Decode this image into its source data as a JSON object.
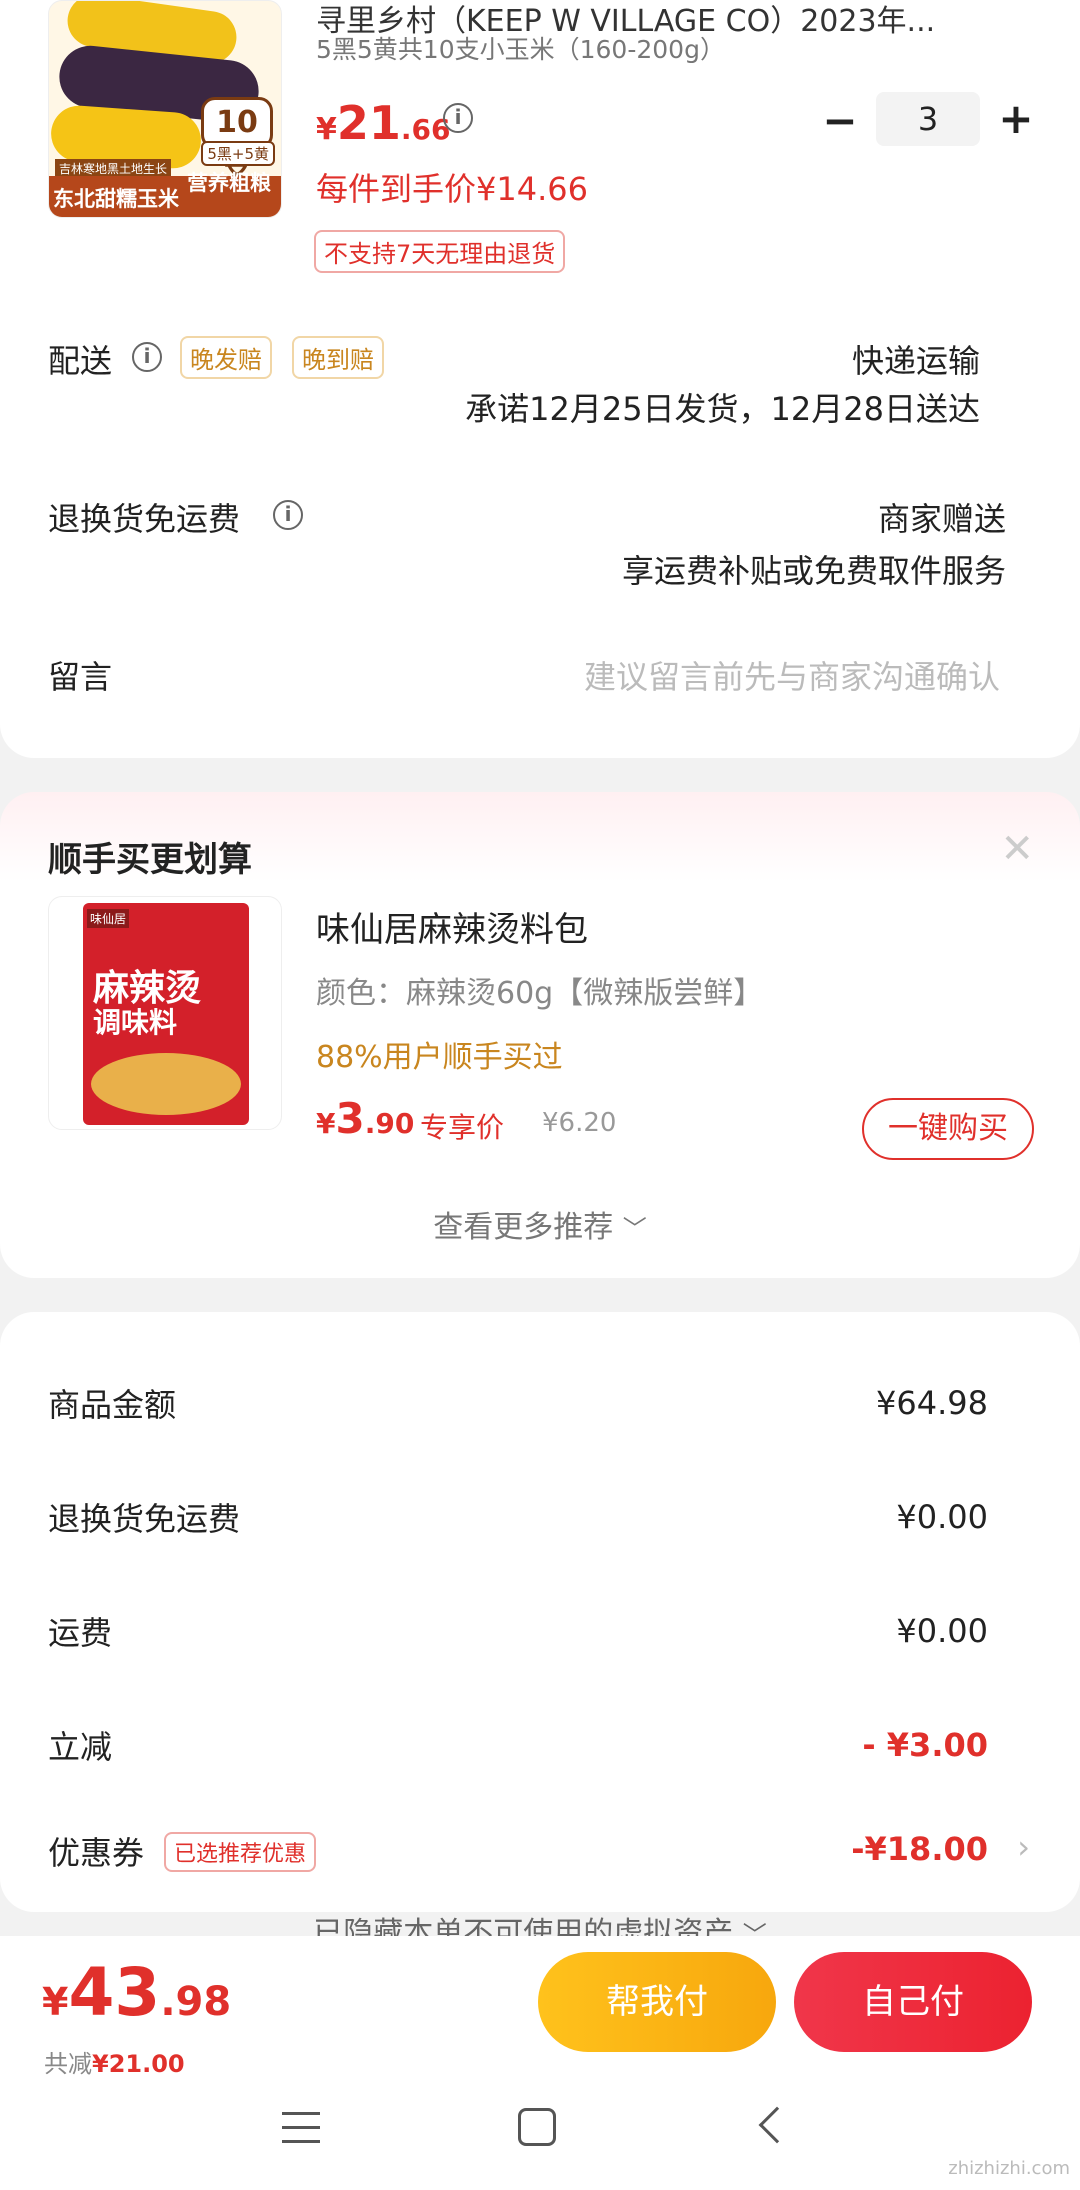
{
  "product": {
    "title_line": "寻里乡村（KEEP W VILLAGE CO）2023年...",
    "spec": "5黑5黄共10支小玉米（160-200g）",
    "price_symbol": "¥",
    "price_int": "21",
    "price_dec": ".66",
    "unit_price_label": "每件到手价¥14.66",
    "quantity": "3",
    "minus": "−",
    "plus": "+",
    "no_return_tag": "不支持7天无理由退货",
    "thumb_badge_count": "10支",
    "thumb_badge_mix": "5黑+5黄",
    "thumb_line1": "吉林寒地黑土地生长",
    "thumb_line2": "东北甜糯玉米",
    "thumb_line3": "营养粗粮"
  },
  "shipping": {
    "label": "配送",
    "tag1": "晚发赔",
    "tag2": "晚到赔",
    "method": "快递运输",
    "promise": "承诺12月25日发货，12月28日送达"
  },
  "return_fee": {
    "label": "退换货免运费",
    "value": "商家赠送",
    "desc": "享运费补贴或免费取件服务"
  },
  "message": {
    "label": "留言",
    "placeholder": "建议留言前先与商家沟通确认"
  },
  "addon": {
    "section_title": "顺手买更划算",
    "close": "✕",
    "name": "味仙居麻辣烫料包",
    "spec": "颜色：麻辣烫60g【微辣版尝鲜】",
    "social": "88%用户顺手买过",
    "price_symbol": "¥",
    "price_int": "3",
    "price_dec": ".90",
    "price_tag": "专享价",
    "orig_price": "¥6.20",
    "buy_button": "一键购买",
    "more": "查看更多推荐",
    "pkg_brand": "味仙居",
    "pkg_title1": "麻辣烫",
    "pkg_title2": "调味料"
  },
  "summary": {
    "rows": [
      {
        "label": "商品金额",
        "value": "¥64.98"
      },
      {
        "label": "退换货免运费",
        "value": "¥0.00"
      },
      {
        "label": "运费",
        "value": "¥0.00"
      },
      {
        "label": "立减",
        "value": "- ¥3.00"
      },
      {
        "label": "优惠券",
        "value": "-¥18.00",
        "tag": "已选推荐优惠"
      }
    ],
    "hidden_assets": "已隐藏本单不可使用的虚拟资产"
  },
  "footer": {
    "price_symbol": "¥",
    "total_int": "43",
    "total_dec": ".98",
    "saved_label": "共减",
    "saved_value": "¥21.00",
    "help_pay": "帮我付",
    "self_pay": "自己付"
  },
  "colors": {
    "accent_red": "#e0302b",
    "gold": "#c9861f",
    "help_btn": "#fbb315",
    "self_btn": "#ee2b3a"
  },
  "watermark": "zhizhizhi.com"
}
